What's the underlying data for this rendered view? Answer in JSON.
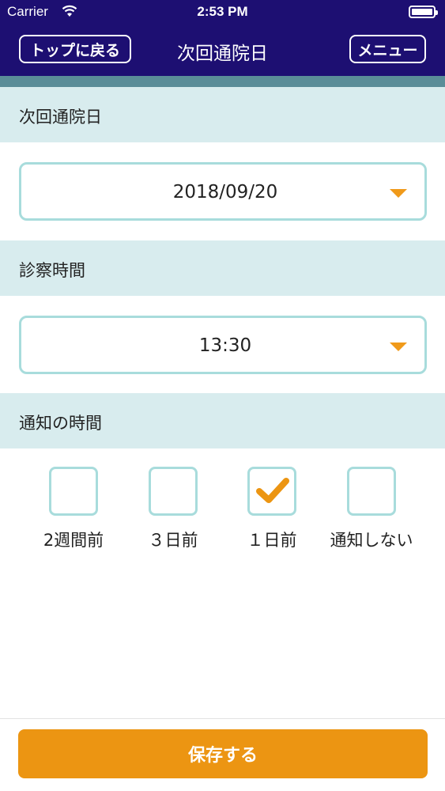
{
  "status_bar": {
    "carrier": "Carrier",
    "time": "2:53 PM"
  },
  "nav": {
    "back_label": "トップに戻る",
    "title": "次回通院日",
    "menu_label": "メニュー"
  },
  "sections": {
    "next_visit": {
      "header": "次回通院日",
      "value": "2018/09/20"
    },
    "exam_time": {
      "header": "診察時間",
      "value": "13:30"
    },
    "notify": {
      "header": "通知の時間",
      "options": [
        {
          "label": "2週間前",
          "checked": false
        },
        {
          "label": "３日前",
          "checked": false
        },
        {
          "label": "１日前",
          "checked": true
        },
        {
          "label": "通知しない",
          "checked": false
        }
      ]
    }
  },
  "save_label": "保存する",
  "colors": {
    "nav_bg": "#1d0f72",
    "accent": "#ec9512",
    "section_bg": "#d8ecee",
    "border": "#a8dcdc"
  }
}
